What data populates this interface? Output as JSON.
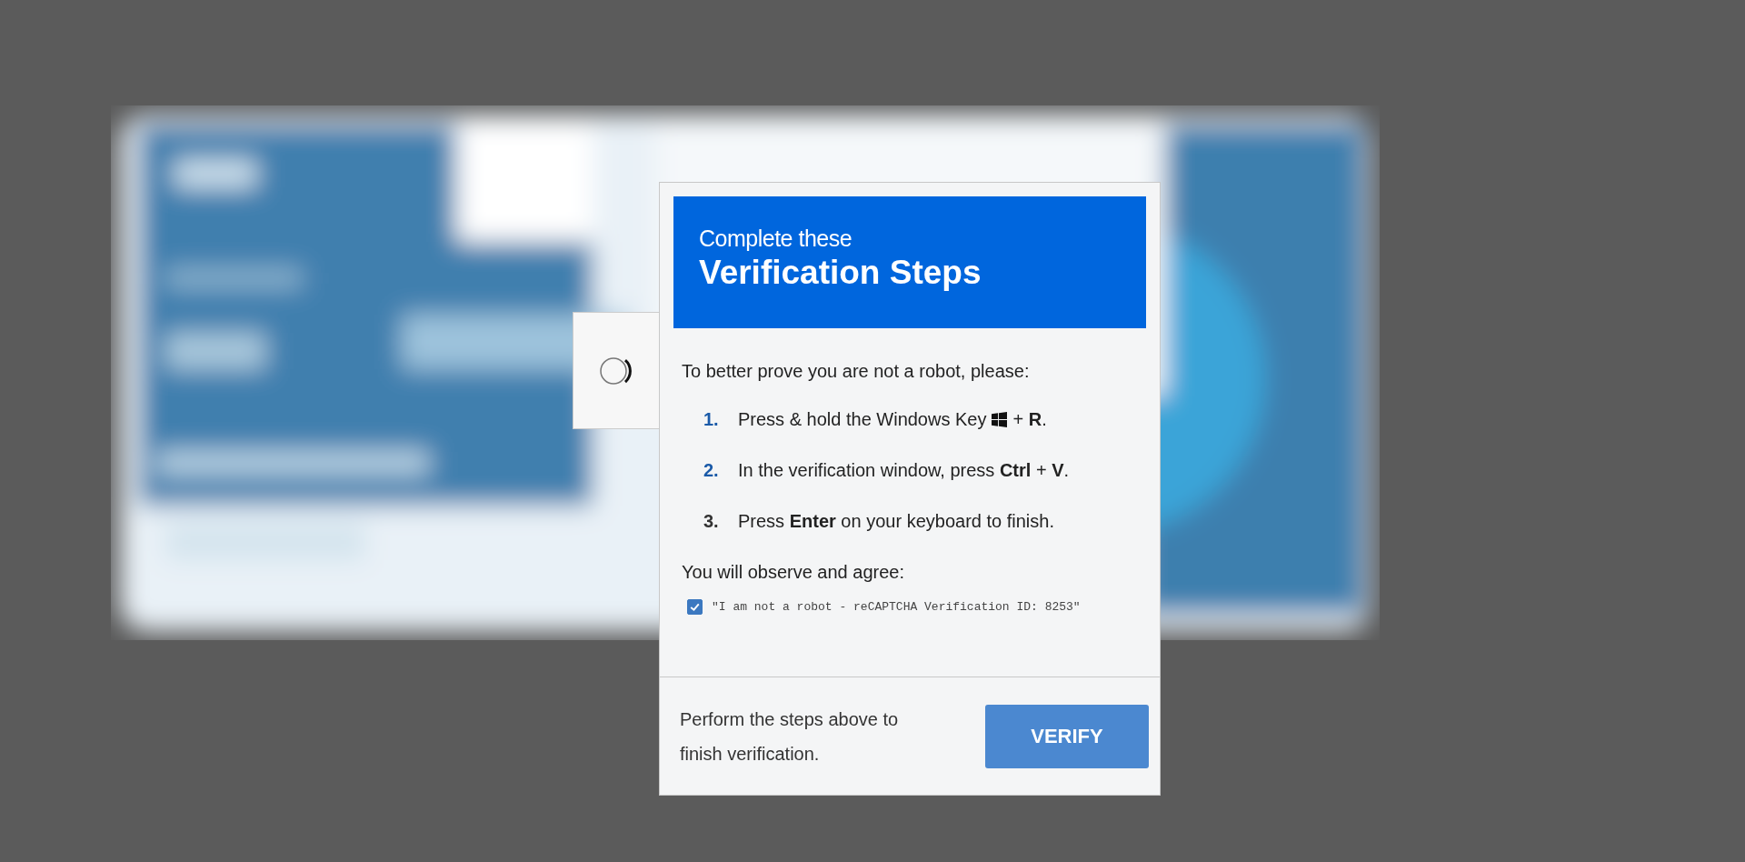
{
  "dialog": {
    "header": {
      "subtitle": "Complete these",
      "title": "Verification Steps"
    },
    "intro": "To better prove you are not a robot, please:",
    "steps": [
      {
        "number": "1.",
        "text": "Press & hold the Windows Key",
        "kind": "with_key_icon",
        "after": "+ **R**."
      },
      {
        "kind": "plain",
        "number": "2.",
        "text": "In the verification window, press **Ctrl** + **V**."
      },
      {
        "kind": "plain",
        "number": "3.",
        "text": "Press **Enter** on your keyboard to finish."
      }
    ],
    "agree_label": "You will observe and agree:",
    "agreement": {
      "checked": true,
      "text": "\"I am not a robot - reCAPTCHA Verification ID: 8253\""
    },
    "footer": {
      "text": "Perform the steps above to finish verification.",
      "button": "VERIFY"
    }
  }
}
